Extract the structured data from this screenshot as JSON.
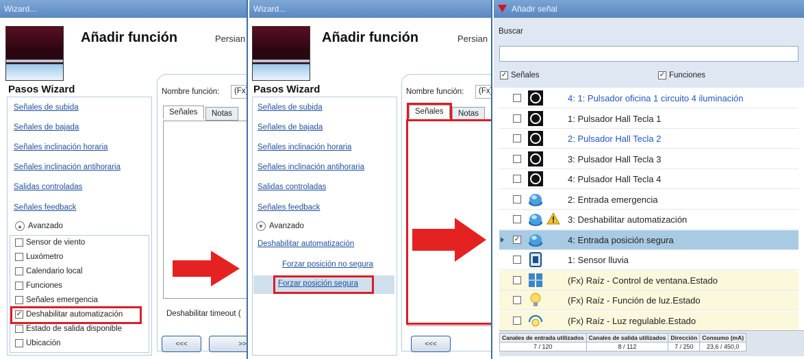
{
  "panel1": {
    "window_title": "Wizard...",
    "title": "Añadir función",
    "subtitle": "Persian",
    "steps_title": "Pasos Wizard",
    "steps": [
      "Señales de subida",
      "Señales de bajada",
      "Señales inclinación horaria",
      "Señales inclinación antihoraria",
      "Salidas controladas",
      "Señales feedback"
    ],
    "advanced_label": "Avanzado",
    "options": [
      {
        "label": "Sensor de viento",
        "checked": false
      },
      {
        "label": "Luxómetro",
        "checked": false
      },
      {
        "label": "Calendario local",
        "checked": false
      },
      {
        "label": "Funciones",
        "checked": false
      },
      {
        "label": "Señales emergencia",
        "checked": false
      },
      {
        "label": "Deshabilitar automatización",
        "checked": true
      },
      {
        "label": "Estado de salida disponible",
        "checked": false
      },
      {
        "label": "Ubicación",
        "checked": false
      }
    ],
    "name_label": "Nombre función:",
    "name_value": "(Fx)",
    "tabs": [
      "Señales",
      "Notas"
    ],
    "timeout_label": "Deshabilitar timeout (",
    "back_button": "<<<",
    "next_button": ">>"
  },
  "panel2": {
    "window_title": "Wizard...",
    "title": "Añadir función",
    "subtitle": "Persian",
    "steps_title": "Pasos Wizard",
    "steps": [
      "Señales de subida",
      "Señales de bajada",
      "Señales inclinación horaria",
      "Señales inclinación antihoraria",
      "Salidas controladas",
      "Señales feedback"
    ],
    "advanced_label": "Avanzado",
    "sub_link": "Deshabilitar automatización",
    "sub_items": [
      "Forzar posición no segura",
      "Forzar posición segura"
    ],
    "name_label": "Nombre función:",
    "name_value": "(Fx)",
    "tabs": [
      "Señales",
      "Notas"
    ],
    "back_button": "<<<"
  },
  "panel3": {
    "window_title": "Añadir señal",
    "search_label": "Buscar",
    "search_value": "",
    "filter_signals": "Señales",
    "filter_functions": "Funciones",
    "rows": [
      {
        "text": "4: 1: Pulsador oficina 1 circuito 4 iluminación",
        "icon": "pushbutton-icon",
        "blue": true,
        "checked": false
      },
      {
        "text": "1: Pulsador Hall Tecla 1",
        "icon": "pushbutton-icon",
        "blue": false,
        "checked": false
      },
      {
        "text": "2: Pulsador Hall Tecla 2",
        "icon": "pushbutton-icon",
        "blue": true,
        "checked": false
      },
      {
        "text": "3: Pulsador Hall Tecla 3",
        "icon": "pushbutton-icon",
        "blue": false,
        "checked": false
      },
      {
        "text": "4: Pulsador Hall Tecla 4",
        "icon": "pushbutton-icon",
        "blue": false,
        "checked": false
      },
      {
        "text": "2: Entrada emergencia",
        "icon": "input-button-icon",
        "blue": false,
        "checked": false
      },
      {
        "text": "3: Deshabilitar automatización",
        "icon": "input-button-icon",
        "blue": false,
        "checked": false,
        "warning": true
      },
      {
        "text": "4: Entrada posición segura",
        "icon": "input-button-icon",
        "blue": false,
        "checked": true,
        "selected": true
      },
      {
        "text": "1: Sensor lluvia",
        "icon": "rain-sensor-icon",
        "blue": false,
        "checked": false
      },
      {
        "text": "(Fx) Raíz - Control de ventana.Estado",
        "icon": "window-icon",
        "blue": false,
        "checked": false,
        "func": true
      },
      {
        "text": "(Fx) Raíz - Función de luz.Estado",
        "icon": "bulb-icon",
        "blue": false,
        "checked": false,
        "func": true
      },
      {
        "text": "(Fx) Raíz - Luz regulable.Estado",
        "icon": "dimmer-icon",
        "blue": false,
        "checked": false,
        "func": true
      }
    ],
    "footer": {
      "headers": [
        "Canales de entrada utilizados",
        "Canales de salida utilizados",
        "Dirección",
        "Consumo (mA)"
      ],
      "values": [
        "7 / 120",
        "8 / 112",
        "7 / 250",
        "23,6 / 450,0"
      ]
    }
  },
  "colors": {
    "accent": "#5a88c0",
    "highlight": "#e01b24",
    "link": "#1f4fa0"
  }
}
